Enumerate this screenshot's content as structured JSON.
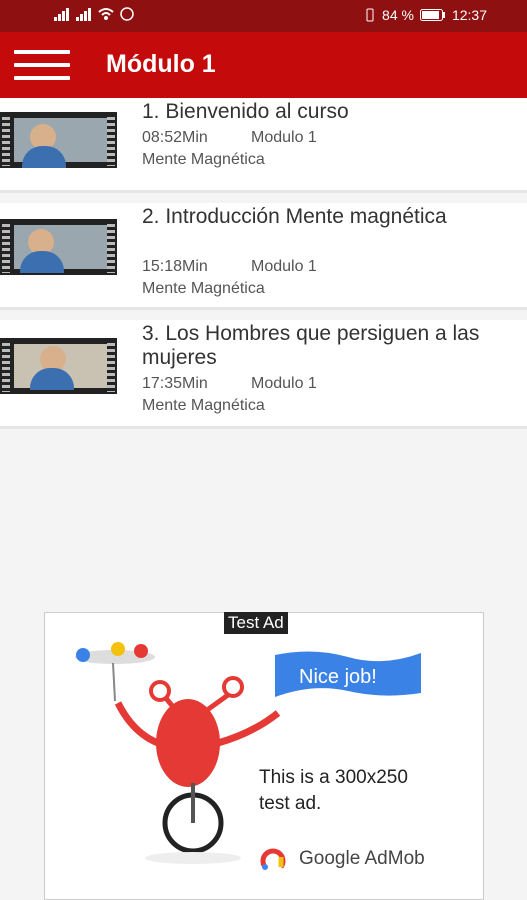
{
  "status_bar": {
    "battery_percent": "84 %",
    "time": "12:37"
  },
  "app_bar": {
    "title": "Módulo 1"
  },
  "videos": [
    {
      "title": "1. Bienvenido al curso",
      "duration": "08:52Min",
      "module": "Modulo 1",
      "course": "Mente Magnética"
    },
    {
      "title": "2. Introducción Mente magnética",
      "duration": "15:18Min",
      "module": "Modulo 1",
      "course": "Mente Magnética"
    },
    {
      "title": "3. Los Hombres que persiguen a las mujeres",
      "duration": "17:35Min",
      "module": "Modulo 1",
      "course": "Mente Magnética"
    }
  ],
  "ad": {
    "label": "Test Ad",
    "flag_text": "Nice job!",
    "line1": "This is a 300x250",
    "line2": "test ad.",
    "brand": "Google AdMob"
  },
  "colors": {
    "status_bar": "#8e1010",
    "app_bar": "#c40a0a",
    "flag": "#3b82e6"
  }
}
